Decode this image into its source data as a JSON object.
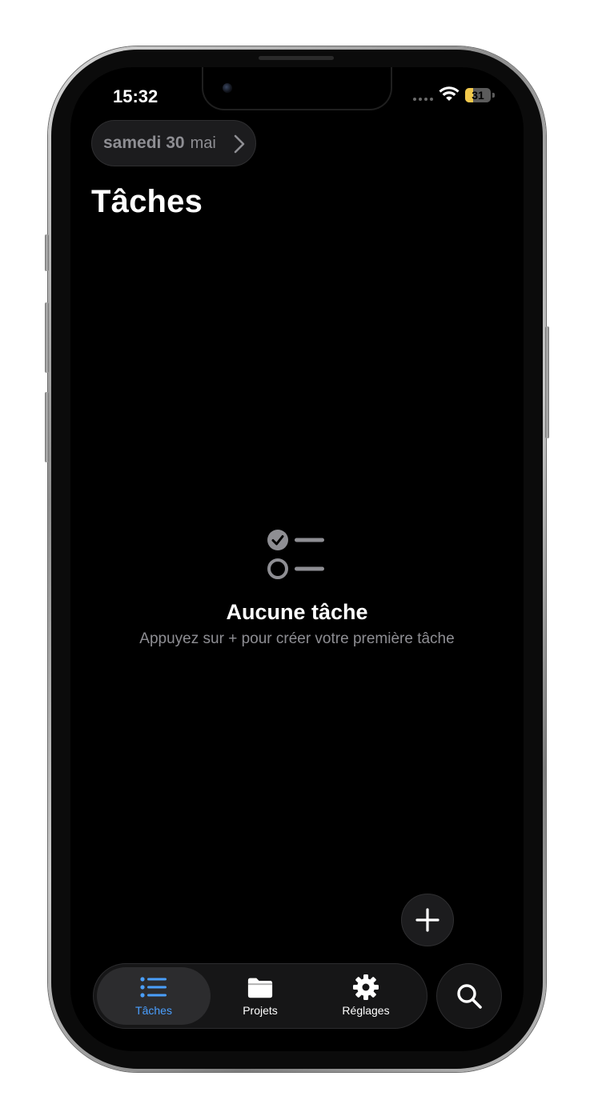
{
  "status_bar": {
    "time": "15:32",
    "battery_level": "31",
    "battery_fraction": 0.31
  },
  "header": {
    "date_day": "samedi 30",
    "date_month": "mai",
    "title": "Tâches"
  },
  "empty_state": {
    "icon": "checklist-icon",
    "title": "Aucune tâche",
    "subtitle": "Appuyez sur + pour créer votre première tâche"
  },
  "fab": {
    "icon": "plus-icon"
  },
  "tab_bar": {
    "tabs": [
      {
        "label": "Tâches",
        "icon": "list-icon",
        "active": true
      },
      {
        "label": "Projets",
        "icon": "folder-icon",
        "active": false
      },
      {
        "label": "Réglages",
        "icon": "gear-icon",
        "active": false
      }
    ],
    "active_color": "#4a9fff"
  },
  "search": {
    "icon": "search-icon"
  },
  "colors": {
    "background": "#000000",
    "surface": "#1c1c1e",
    "secondary_text": "#8e8e93",
    "accent": "#4a9fff",
    "battery": "#f2c94c"
  }
}
